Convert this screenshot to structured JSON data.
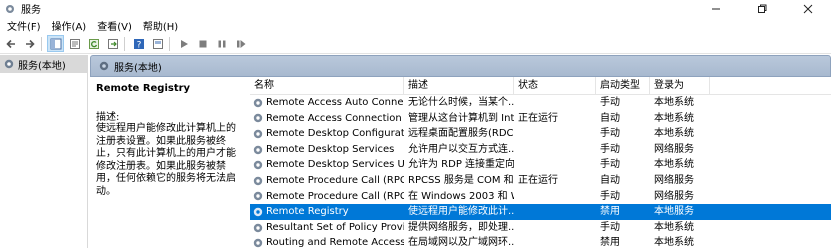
{
  "window": {
    "title": "服务",
    "minimize_icon": "minimize-icon",
    "maximize_icon": "maximize-icon",
    "close_icon": "close-icon"
  },
  "menu": [
    "文件(F)",
    "操作(A)",
    "查看(V)",
    "帮助(H)"
  ],
  "toolbar": {
    "icons": [
      "back-arrow-icon",
      "forward-arrow-icon",
      "console-tree-icon",
      "properties-icon",
      "refresh-icon",
      "export-icon",
      "help-icon",
      "view-icon",
      "play-icon",
      "stop-icon",
      "pause-icon",
      "restart-icon"
    ]
  },
  "tree": {
    "label": "服务(本地)"
  },
  "panel": {
    "title": "服务(本地)",
    "selected_service": "Remote Registry",
    "desc_label": "描述:",
    "desc_text": "使远程用户能修改此计算机上的注册表设置。如果此服务被终止，只有此计算机上的用户才能修改注册表。如果此服务被禁用，任何依赖它的服务将无法启动。"
  },
  "columns": {
    "name": "名称",
    "desc": "描述",
    "status": "状态",
    "startup": "启动类型",
    "logon": "登录为"
  },
  "services": [
    {
      "name": "Remote Access Auto Connection...",
      "desc": "无论什么时候，当某个...",
      "status": "",
      "startup": "手动",
      "logon": "本地系统"
    },
    {
      "name": "Remote Access Connection Man...",
      "desc": "管理从这台计算机到 Int...",
      "status": "正在运行",
      "startup": "自动",
      "logon": "本地系统"
    },
    {
      "name": "Remote Desktop Configuration",
      "desc": "远程桌面配置服务(RDC...",
      "status": "",
      "startup": "手动",
      "logon": "本地系统"
    },
    {
      "name": "Remote Desktop Services",
      "desc": "允许用户以交互方式连...",
      "status": "",
      "startup": "手动",
      "logon": "网络服务"
    },
    {
      "name": "Remote Desktop Services UserM...",
      "desc": "允许为 RDP 连接重定向...",
      "status": "",
      "startup": "手动",
      "logon": "本地系统"
    },
    {
      "name": "Remote Procedure Call (RPC)",
      "desc": "RPCSS 服务是 COM 和 ...",
      "status": "正在运行",
      "startup": "自动",
      "logon": "网络服务"
    },
    {
      "name": "Remote Procedure Call (RPC) Lo...",
      "desc": "在 Windows 2003 和 W...",
      "status": "",
      "startup": "手动",
      "logon": "网络服务"
    },
    {
      "name": "Remote Registry",
      "desc": "使远程用户能修改此计...",
      "status": "",
      "startup": "禁用",
      "logon": "本地服务",
      "selected": true
    },
    {
      "name": "Resultant Set of Policy Provider",
      "desc": "提供网络服务，即处理...",
      "status": "",
      "startup": "手动",
      "logon": "本地系统"
    },
    {
      "name": "Routing and Remote Access",
      "desc": "在局域网以及广域网环...",
      "status": "",
      "startup": "禁用",
      "logon": "本地系统"
    }
  ]
}
